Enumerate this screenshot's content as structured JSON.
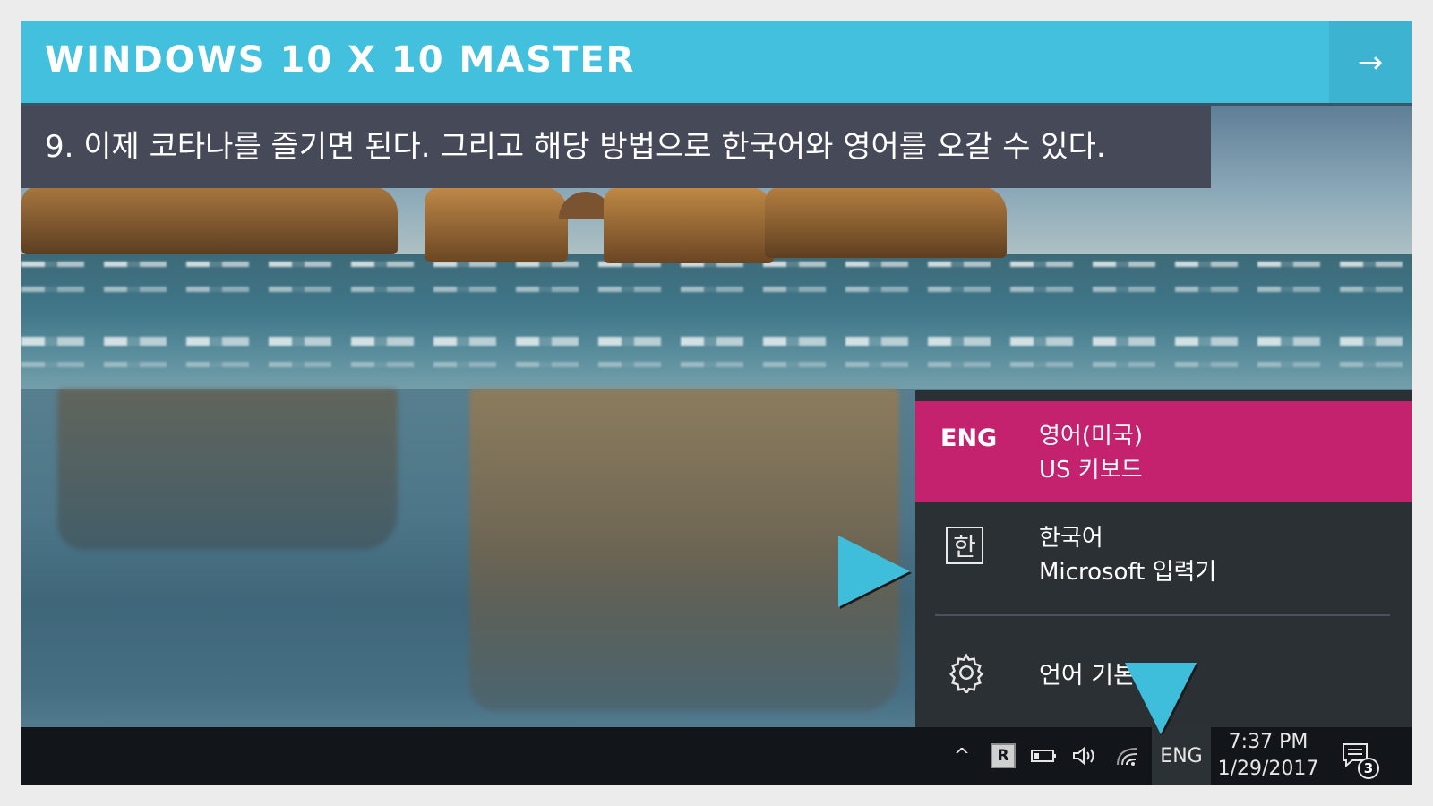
{
  "slide": {
    "title": "WINDOWS 10 X 10 MASTER",
    "next_arrow": "→",
    "caption": "9. 이제 코타나를 즐기면 된다. 그리고 해당 방법으로 한국어와 영어를 오갈 수 있다.",
    "accent_color": "#42c0de"
  },
  "language_flyout": {
    "items": [
      {
        "code": "ENG",
        "name": "영어(미국)",
        "keyboard": "US 키보드",
        "selected": true,
        "highlight_color": "#c4226f"
      },
      {
        "code_glyph": "한",
        "name": "한국어",
        "keyboard": "Microsoft 입력기",
        "selected": false
      }
    ],
    "preferences_label": "언어 기본 설정",
    "preferences_icon": "gear-icon"
  },
  "taskbar": {
    "tray_icons": [
      "chevron-up-icon",
      "r-app-icon",
      "battery-icon",
      "volume-icon",
      "wifi-icon"
    ],
    "r_badge": "R",
    "chevron": "^",
    "volume_glyph": "🔈",
    "language_indicator": "ENG",
    "time": "7:37 PM",
    "date": "1/29/2017",
    "notification_count": "3"
  }
}
